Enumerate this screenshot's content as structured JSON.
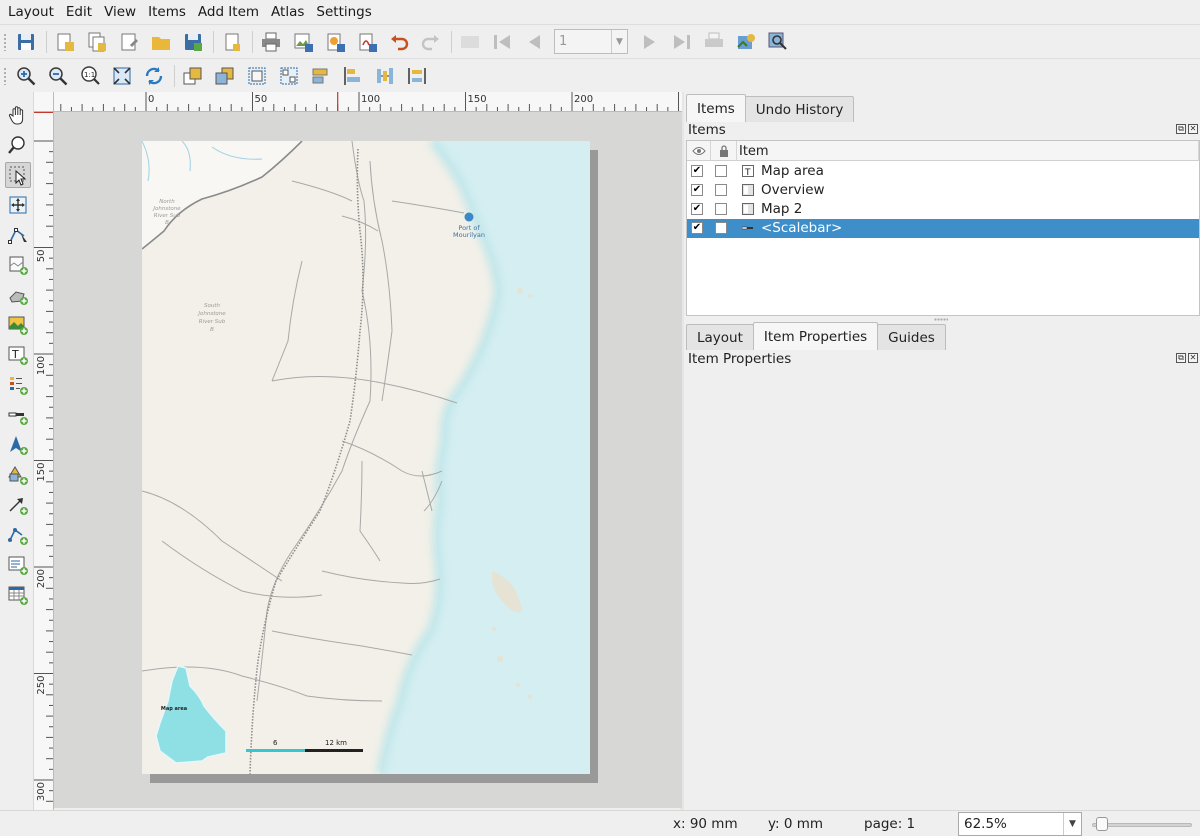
{
  "menubar": {
    "items": [
      "Layout",
      "Edit",
      "View",
      "Items",
      "Add Item",
      "Atlas",
      "Settings"
    ],
    "mnemonics": [
      "L",
      "E",
      "V",
      "I",
      "A",
      "A",
      "S"
    ]
  },
  "toolbar": {
    "page_number": "1"
  },
  "rulers": {
    "h_labels": [
      "0",
      "50",
      "100",
      "150",
      "200",
      "2"
    ],
    "v_labels": [
      "50",
      "100",
      "150",
      "200",
      "250",
      "300"
    ]
  },
  "map": {
    "port_label_1": "Port of",
    "port_label_2": "Mourilyan",
    "north_johnstone_1": "North",
    "north_johnstone_2": "Johnstone",
    "north_johnstone_3": "River Sub",
    "north_johnstone_4": "B",
    "south_johnstone_1": "South",
    "south_johnstone_2": "Johnstone",
    "south_johnstone_3": "River Sub",
    "south_johnstone_4": "B",
    "inset_label": "Map area",
    "scalebar_label_mid": "6",
    "scalebar_label_end": "12 km",
    "colors": {
      "land": "#f2f0e8",
      "sea": "#d4eef1",
      "inset": "#8fe0e5",
      "scale_cyan": "#35c6cf"
    }
  },
  "dock": {
    "tabs_top": [
      "Items",
      "Undo History"
    ],
    "items_panel_title": "Items",
    "tree_header_item": "Item",
    "items": [
      {
        "label": "Map area",
        "visible": true,
        "locked": false,
        "icon": "label-item-icon",
        "selected": false
      },
      {
        "label": "Overview",
        "visible": true,
        "locked": false,
        "icon": "map-item-icon",
        "selected": false
      },
      {
        "label": "Map 2",
        "visible": true,
        "locked": false,
        "icon": "map-item-icon",
        "selected": false
      },
      {
        "label": "<Scalebar>",
        "visible": true,
        "locked": false,
        "icon": "scalebar-item-icon",
        "selected": true
      }
    ],
    "tabs_bottom": [
      "Layout",
      "Item Properties",
      "Guides"
    ],
    "props_panel_title": "Item Properties"
  },
  "statusbar": {
    "x": "x: 90 mm",
    "y": "y: 0 mm",
    "page": "page: 1",
    "zoom": "62.5%"
  }
}
